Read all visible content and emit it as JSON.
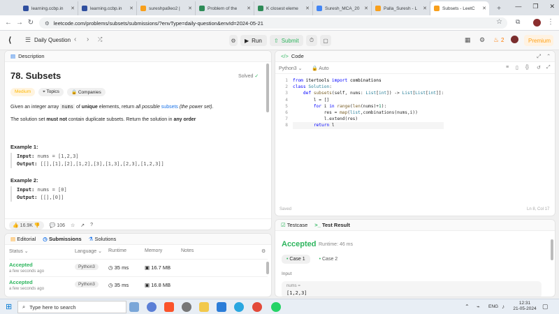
{
  "browser": {
    "tabs": [
      {
        "title": "learning.ccbp.in",
        "color": "#2f4f9f"
      },
      {
        "title": "learning.ccbp.in",
        "color": "#2f4f9f"
      },
      {
        "title": "sureshpa9eo2 |",
        "color": "#f89f1b"
      },
      {
        "title": "Problem of the",
        "color": "#2e8b57"
      },
      {
        "title": "K closest eleme",
        "color": "#2e8b57"
      },
      {
        "title": "Suresh_MCA_20",
        "color": "#4285f4"
      },
      {
        "title": "Palla_Suresh - L",
        "color": "#f89f1b"
      },
      {
        "title": "Subsets - LeetC",
        "color": "#f89f1b"
      }
    ],
    "new_tab": "+",
    "url": "leetcode.com/problems/subsets/submissions/?envType=daily-question&envId=2024-05-21"
  },
  "nav": {
    "title": "Daily Question",
    "run": "Run",
    "submit": "Submit",
    "streak": "2",
    "premium": "Premium"
  },
  "desc": {
    "tab": "Description",
    "title": "78. Subsets",
    "solved": "Solved",
    "tag_medium": "Medium",
    "tag_topics": "Topics",
    "tag_companies": "Companies",
    "p1a": "Given an integer array ",
    "p1b": "nums",
    "p1c": " of ",
    "p1d": "unique",
    "p1e": " elements, return ",
    "p1f": "all possible",
    "p1g": " subsets",
    "p1h": " (the power set).",
    "p2a": "The solution set ",
    "p2b": "must not",
    "p2c": " contain duplicate subsets. Return the solution in ",
    "p2d": "any order",
    ".": ".",
    "ex1": "Example 1:",
    "ex1_in_label": "Input:",
    "ex1_in": "nums = [1,2,3]",
    "ex1_out_label": "Output:",
    "ex1_out": "[[],[1],[2],[1,2],[3],[1,3],[2,3],[1,2,3]]",
    "ex2": "Example 2:",
    "ex2_in_label": "Input:",
    "ex2_in": "nums = [0]",
    "ex2_out_label": "Output:",
    "ex2_out": "[[],[0]]",
    "likes": "16.9K",
    "comments": "106"
  },
  "subs": {
    "tabs": [
      "Editorial",
      "Submissions",
      "Solutions"
    ],
    "cols": [
      "Status",
      "Language",
      "Runtime",
      "Memory",
      "Notes"
    ],
    "rows": [
      {
        "status": "Accepted",
        "time": "a few seconds ago",
        "lang": "Python3",
        "runtime": "35 ms",
        "memory": "16.7 MB"
      },
      {
        "status": "Accepted",
        "time": "a few seconds ago",
        "lang": "Python3",
        "runtime": "35 ms",
        "memory": "16.8 MB"
      }
    ]
  },
  "code": {
    "tab": "Code",
    "lang": "Python3",
    "mode": "Auto",
    "saved": "Saved",
    "pos": "Ln 8, Col 17",
    "lines": [
      "1",
      "2",
      "3",
      "4",
      "5",
      "6",
      "7",
      "8"
    ]
  },
  "result": {
    "tab1": "Testcase",
    "tab2": "Test Result",
    "status": "Accepted",
    "runtime": "Runtime: 46 ms",
    "case1": "Case 1",
    "case2": "Case 2",
    "input_label": "Input",
    "var": "nums =",
    "val": "[1,2,3]"
  },
  "taskbar": {
    "search": "Type here to search",
    "lang": "ENG",
    "time": "12:31",
    "date": "21-05-2024"
  }
}
